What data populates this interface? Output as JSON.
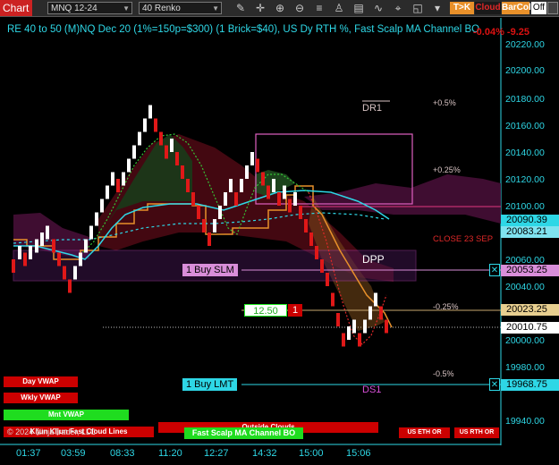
{
  "toolbar": {
    "chart_label": "Chart",
    "instrument": "MNQ 12-24",
    "bar_type": "40 Renko",
    "tick_button": "T>K",
    "cloud_button": "Cloud",
    "barcol_button": "BarCol",
    "off_button": "Off",
    "icons": [
      "pencil-icon",
      "crosshair-icon",
      "zoom-in-icon",
      "zoom-out-icon",
      "properties-icon",
      "strategy-icon",
      "chart-trader-icon",
      "chevron-down-icon",
      "toggle-icon"
    ]
  },
  "title": "RE 40 to 50 (M)NQ Dec 20 (1%=150p=$300) (1 Brick=$40), US Dy RTH %, Fast Scalp MA Channel BO",
  "title_right": "-0.04% -9.25",
  "price_axis": {
    "labels": [
      "20220.00",
      "20200.00",
      "20180.00",
      "20160.00",
      "20140.00",
      "20120.00",
      "20100.00",
      "20060.00",
      "20040.00",
      "20000.00",
      "19980.00",
      "19940.00"
    ]
  },
  "price_tags": [
    {
      "value": "20090.39",
      "bg": "#2ed7e6",
      "fg": "#000000"
    },
    {
      "value": "20083.21",
      "bg": "#7fe3f0",
      "fg": "#000000"
    },
    {
      "value": "20053.25",
      "bg": "#d98ed9",
      "fg": "#000000"
    },
    {
      "value": "20023.25",
      "bg": "#e8cf90",
      "fg": "#000000"
    },
    {
      "value": "20010.75",
      "bg": "#ffffff",
      "fg": "#000000"
    },
    {
      "value": "19968.75",
      "bg": "#2ed7e6",
      "fg": "#000000"
    }
  ],
  "time_axis": [
    "01:37",
    "03:59",
    "08:33",
    "11:20",
    "12:27",
    "14:32",
    "15:00",
    "15:06"
  ],
  "levels": {
    "dr1": "DR1",
    "dpp": "DPP",
    "ds1": "DS1",
    "pct_plus_05": "+0.5%",
    "pct_plus_025": "+0.25%",
    "pct_minus_025": "-0.25%",
    "pct_minus_05": "-0.5%",
    "close_label": "CLOSE 23 SEP"
  },
  "orders": {
    "buy_slm": "1 Buy SLM",
    "buy_lmt": "1 Buy LMT",
    "position_price": "12.50",
    "position_qty": "1"
  },
  "legend": {
    "day_vwap": "Day VWAP",
    "wkly_vwap": "Wkly VWAP",
    "mnt_vwap": "Mnt VWAP",
    "outside_clouds": "Outside Clouds",
    "kijun_label": "Kijun Kijun Fast Cloud Lines",
    "fast_scalp": "Fast Scalp MA Channel BO",
    "us_eth": "US ETH OR",
    "us_rth": "US RTH OR",
    "copyright": "© 2024 NinjaTrader, LLC"
  },
  "colors": {
    "accent_cyan": "#2ed7e6",
    "up_brick": "#ffffff",
    "down_brick": "#e01818",
    "magenta": "#d84fd8",
    "orange": "#e8902a"
  },
  "chart_data": {
    "type": "line",
    "title": "RE 40 to 50 (M)NQ Dec 20 (1%=150p=$300) (1 Brick=$40), US Dy RTH %, Fast Scalp MA Channel BO",
    "x_ticks": [
      "01:37",
      "03:59",
      "08:33",
      "11:20",
      "12:27",
      "14:32",
      "15:00",
      "15:06"
    ],
    "ylim": [
      19930,
      20235
    ],
    "y_ticks": [
      19940,
      19960,
      19980,
      20000,
      20020,
      20040,
      20060,
      20080,
      20100,
      20120,
      20140,
      20160,
      20180,
      20200,
      20220
    ],
    "bricks": [
      {
        "x": 15,
        "o": 20050,
        "c": 20060,
        "dir": "down"
      },
      {
        "x": 22,
        "o": 20060,
        "c": 20070,
        "dir": "up"
      },
      {
        "x": 28,
        "o": 20055,
        "c": 20065,
        "dir": "down"
      },
      {
        "x": 34,
        "o": 20060,
        "c": 20070,
        "dir": "up"
      },
      {
        "x": 41,
        "o": 20065,
        "c": 20075,
        "dir": "up"
      },
      {
        "x": 47,
        "o": 20070,
        "c": 20080,
        "dir": "up"
      },
      {
        "x": 53,
        "o": 20075,
        "c": 20085,
        "dir": "up"
      },
      {
        "x": 60,
        "o": 20065,
        "c": 20075,
        "dir": "down"
      },
      {
        "x": 66,
        "o": 20055,
        "c": 20065,
        "dir": "down"
      },
      {
        "x": 72,
        "o": 20045,
        "c": 20055,
        "dir": "down"
      },
      {
        "x": 78,
        "o": 20035,
        "c": 20045,
        "dir": "down"
      },
      {
        "x": 84,
        "o": 20045,
        "c": 20055,
        "dir": "up"
      },
      {
        "x": 90,
        "o": 20055,
        "c": 20065,
        "dir": "up"
      },
      {
        "x": 96,
        "o": 20065,
        "c": 20075,
        "dir": "up"
      },
      {
        "x": 102,
        "o": 20075,
        "c": 20085,
        "dir": "up"
      },
      {
        "x": 108,
        "o": 20085,
        "c": 20095,
        "dir": "up"
      },
      {
        "x": 114,
        "o": 20095,
        "c": 20105,
        "dir": "up"
      },
      {
        "x": 120,
        "o": 20105,
        "c": 20115,
        "dir": "up"
      },
      {
        "x": 126,
        "o": 20115,
        "c": 20125,
        "dir": "up"
      },
      {
        "x": 132,
        "o": 20110,
        "c": 20120,
        "dir": "down"
      },
      {
        "x": 138,
        "o": 20115,
        "c": 20125,
        "dir": "up"
      },
      {
        "x": 144,
        "o": 20125,
        "c": 20135,
        "dir": "up"
      },
      {
        "x": 150,
        "o": 20135,
        "c": 20145,
        "dir": "up"
      },
      {
        "x": 156,
        "o": 20145,
        "c": 20155,
        "dir": "up"
      },
      {
        "x": 162,
        "o": 20155,
        "c": 20165,
        "dir": "up"
      },
      {
        "x": 168,
        "o": 20165,
        "c": 20175,
        "dir": "up"
      },
      {
        "x": 174,
        "o": 20155,
        "c": 20165,
        "dir": "down"
      },
      {
        "x": 180,
        "o": 20145,
        "c": 20155,
        "dir": "down"
      },
      {
        "x": 186,
        "o": 20135,
        "c": 20145,
        "dir": "down"
      },
      {
        "x": 192,
        "o": 20140,
        "c": 20150,
        "dir": "up"
      },
      {
        "x": 198,
        "o": 20130,
        "c": 20140,
        "dir": "down"
      },
      {
        "x": 204,
        "o": 20120,
        "c": 20130,
        "dir": "down"
      },
      {
        "x": 210,
        "o": 20110,
        "c": 20120,
        "dir": "down"
      },
      {
        "x": 216,
        "o": 20100,
        "c": 20110,
        "dir": "down"
      },
      {
        "x": 222,
        "o": 20090,
        "c": 20100,
        "dir": "down"
      },
      {
        "x": 228,
        "o": 20080,
        "c": 20090,
        "dir": "down"
      },
      {
        "x": 234,
        "o": 20070,
        "c": 20080,
        "dir": "down"
      },
      {
        "x": 240,
        "o": 20080,
        "c": 20090,
        "dir": "up"
      },
      {
        "x": 246,
        "o": 20090,
        "c": 20100,
        "dir": "up"
      },
      {
        "x": 252,
        "o": 20100,
        "c": 20110,
        "dir": "up"
      },
      {
        "x": 258,
        "o": 20110,
        "c": 20120,
        "dir": "up"
      },
      {
        "x": 264,
        "o": 20100,
        "c": 20110,
        "dir": "down"
      },
      {
        "x": 270,
        "o": 20110,
        "c": 20120,
        "dir": "up"
      },
      {
        "x": 276,
        "o": 20120,
        "c": 20130,
        "dir": "up"
      },
      {
        "x": 282,
        "o": 20130,
        "c": 20140,
        "dir": "up"
      },
      {
        "x": 288,
        "o": 20125,
        "c": 20135,
        "dir": "down"
      },
      {
        "x": 294,
        "o": 20115,
        "c": 20125,
        "dir": "down"
      },
      {
        "x": 300,
        "o": 20105,
        "c": 20115,
        "dir": "down"
      },
      {
        "x": 306,
        "o": 20110,
        "c": 20120,
        "dir": "up"
      },
      {
        "x": 312,
        "o": 20100,
        "c": 20110,
        "dir": "down"
      },
      {
        "x": 318,
        "o": 20105,
        "c": 20115,
        "dir": "up"
      },
      {
        "x": 324,
        "o": 20095,
        "c": 20105,
        "dir": "down"
      },
      {
        "x": 330,
        "o": 20100,
        "c": 20110,
        "dir": "up"
      },
      {
        "x": 336,
        "o": 20090,
        "c": 20100,
        "dir": "down"
      },
      {
        "x": 342,
        "o": 20080,
        "c": 20090,
        "dir": "down"
      },
      {
        "x": 348,
        "o": 20070,
        "c": 20080,
        "dir": "down"
      },
      {
        "x": 354,
        "o": 20060,
        "c": 20070,
        "dir": "down"
      },
      {
        "x": 360,
        "o": 20050,
        "c": 20060,
        "dir": "down"
      },
      {
        "x": 366,
        "o": 20040,
        "c": 20050,
        "dir": "down"
      },
      {
        "x": 372,
        "o": 20025,
        "c": 20035,
        "dir": "down"
      },
      {
        "x": 378,
        "o": 20010,
        "c": 20020,
        "dir": "down"
      },
      {
        "x": 384,
        "o": 19995,
        "c": 20005,
        "dir": "down"
      },
      {
        "x": 390,
        "o": 20000,
        "c": 20010,
        "dir": "up"
      },
      {
        "x": 396,
        "o": 20005,
        "c": 20015,
        "dir": "up"
      },
      {
        "x": 402,
        "o": 19995,
        "c": 20005,
        "dir": "down"
      },
      {
        "x": 408,
        "o": 20005,
        "c": 20015,
        "dir": "up"
      },
      {
        "x": 414,
        "o": 20015,
        "c": 20025,
        "dir": "up"
      },
      {
        "x": 420,
        "o": 20025,
        "c": 20035,
        "dir": "up"
      },
      {
        "x": 426,
        "o": 20015,
        "c": 20025,
        "dir": "down"
      },
      {
        "x": 432,
        "o": 20005,
        "c": 20015,
        "dir": "down"
      }
    ]
  }
}
